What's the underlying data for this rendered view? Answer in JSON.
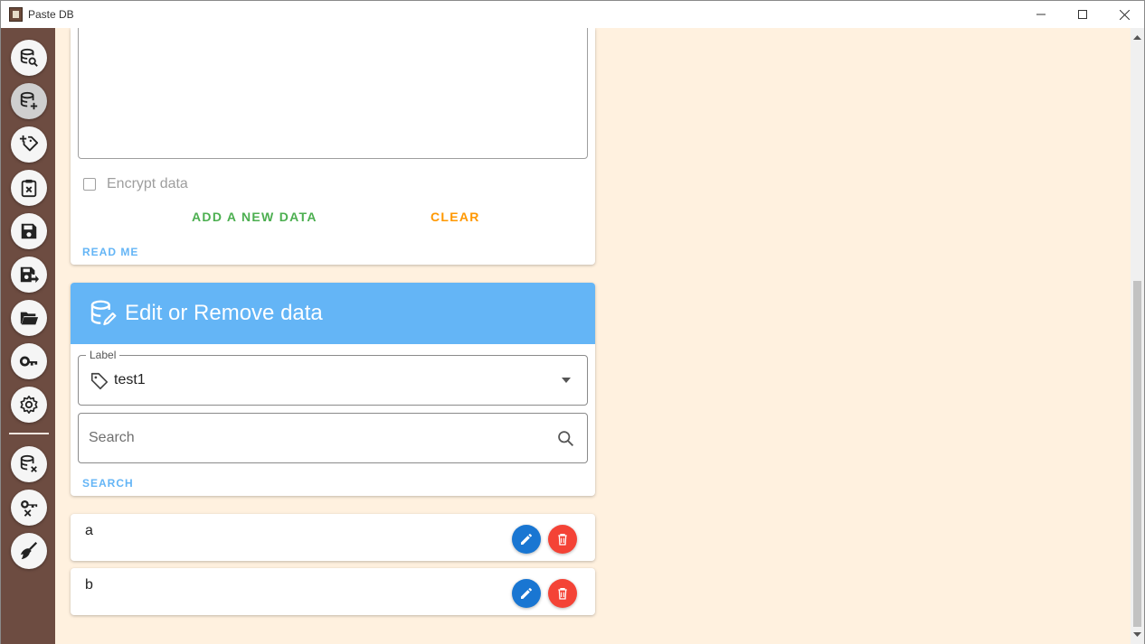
{
  "window": {
    "title": "Paste DB"
  },
  "sidebar": {
    "items": [
      {
        "icon": "database-search-icon",
        "active": false
      },
      {
        "icon": "database-plus-icon",
        "active": true
      },
      {
        "icon": "tag-plus-icon",
        "active": false
      },
      {
        "icon": "clipboard-remove-icon",
        "active": false
      },
      {
        "icon": "save-icon",
        "active": false
      },
      {
        "icon": "save-export-icon",
        "active": false
      },
      {
        "icon": "folder-open-icon",
        "active": false
      },
      {
        "icon": "key-icon",
        "active": false
      },
      {
        "icon": "gear-icon",
        "active": false
      },
      {
        "icon": "database-remove-icon",
        "active": false
      },
      {
        "icon": "key-remove-icon",
        "active": false
      },
      {
        "icon": "broom-icon",
        "active": false
      }
    ]
  },
  "add_card": {
    "encrypt_label": "Encrypt data",
    "add_label": "ADD A NEW DATA",
    "clear_label": "CLEAR",
    "readme_label": "READ ME"
  },
  "edit_card": {
    "title": "Edit or Remove data",
    "label_field": {
      "label": "Label",
      "value": "test1"
    },
    "search_placeholder": "Search",
    "search_button": "SEARCH"
  },
  "results": [
    {
      "text": "a"
    },
    {
      "text": "b"
    }
  ],
  "colors": {
    "sidebar": "#6d4c41",
    "background": "#fff1df",
    "header": "#64b5f6",
    "add_green": "#4caf50",
    "clear_orange": "#ff9800",
    "edit_blue": "#1976d2",
    "delete_red": "#f44336"
  }
}
